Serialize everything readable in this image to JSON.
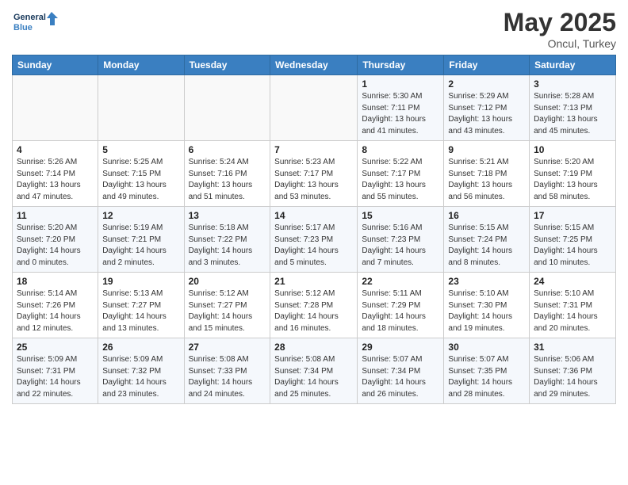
{
  "header": {
    "logo_line1": "General",
    "logo_line2": "Blue",
    "month": "May 2025",
    "location": "Oncul, Turkey"
  },
  "weekdays": [
    "Sunday",
    "Monday",
    "Tuesday",
    "Wednesday",
    "Thursday",
    "Friday",
    "Saturday"
  ],
  "weeks": [
    [
      {
        "day": "",
        "info": ""
      },
      {
        "day": "",
        "info": ""
      },
      {
        "day": "",
        "info": ""
      },
      {
        "day": "",
        "info": ""
      },
      {
        "day": "1",
        "info": "Sunrise: 5:30 AM\nSunset: 7:11 PM\nDaylight: 13 hours\nand 41 minutes."
      },
      {
        "day": "2",
        "info": "Sunrise: 5:29 AM\nSunset: 7:12 PM\nDaylight: 13 hours\nand 43 minutes."
      },
      {
        "day": "3",
        "info": "Sunrise: 5:28 AM\nSunset: 7:13 PM\nDaylight: 13 hours\nand 45 minutes."
      }
    ],
    [
      {
        "day": "4",
        "info": "Sunrise: 5:26 AM\nSunset: 7:14 PM\nDaylight: 13 hours\nand 47 minutes."
      },
      {
        "day": "5",
        "info": "Sunrise: 5:25 AM\nSunset: 7:15 PM\nDaylight: 13 hours\nand 49 minutes."
      },
      {
        "day": "6",
        "info": "Sunrise: 5:24 AM\nSunset: 7:16 PM\nDaylight: 13 hours\nand 51 minutes."
      },
      {
        "day": "7",
        "info": "Sunrise: 5:23 AM\nSunset: 7:17 PM\nDaylight: 13 hours\nand 53 minutes."
      },
      {
        "day": "8",
        "info": "Sunrise: 5:22 AM\nSunset: 7:17 PM\nDaylight: 13 hours\nand 55 minutes."
      },
      {
        "day": "9",
        "info": "Sunrise: 5:21 AM\nSunset: 7:18 PM\nDaylight: 13 hours\nand 56 minutes."
      },
      {
        "day": "10",
        "info": "Sunrise: 5:20 AM\nSunset: 7:19 PM\nDaylight: 13 hours\nand 58 minutes."
      }
    ],
    [
      {
        "day": "11",
        "info": "Sunrise: 5:20 AM\nSunset: 7:20 PM\nDaylight: 14 hours\nand 0 minutes."
      },
      {
        "day": "12",
        "info": "Sunrise: 5:19 AM\nSunset: 7:21 PM\nDaylight: 14 hours\nand 2 minutes."
      },
      {
        "day": "13",
        "info": "Sunrise: 5:18 AM\nSunset: 7:22 PM\nDaylight: 14 hours\nand 3 minutes."
      },
      {
        "day": "14",
        "info": "Sunrise: 5:17 AM\nSunset: 7:23 PM\nDaylight: 14 hours\nand 5 minutes."
      },
      {
        "day": "15",
        "info": "Sunrise: 5:16 AM\nSunset: 7:23 PM\nDaylight: 14 hours\nand 7 minutes."
      },
      {
        "day": "16",
        "info": "Sunrise: 5:15 AM\nSunset: 7:24 PM\nDaylight: 14 hours\nand 8 minutes."
      },
      {
        "day": "17",
        "info": "Sunrise: 5:15 AM\nSunset: 7:25 PM\nDaylight: 14 hours\nand 10 minutes."
      }
    ],
    [
      {
        "day": "18",
        "info": "Sunrise: 5:14 AM\nSunset: 7:26 PM\nDaylight: 14 hours\nand 12 minutes."
      },
      {
        "day": "19",
        "info": "Sunrise: 5:13 AM\nSunset: 7:27 PM\nDaylight: 14 hours\nand 13 minutes."
      },
      {
        "day": "20",
        "info": "Sunrise: 5:12 AM\nSunset: 7:27 PM\nDaylight: 14 hours\nand 15 minutes."
      },
      {
        "day": "21",
        "info": "Sunrise: 5:12 AM\nSunset: 7:28 PM\nDaylight: 14 hours\nand 16 minutes."
      },
      {
        "day": "22",
        "info": "Sunrise: 5:11 AM\nSunset: 7:29 PM\nDaylight: 14 hours\nand 18 minutes."
      },
      {
        "day": "23",
        "info": "Sunrise: 5:10 AM\nSunset: 7:30 PM\nDaylight: 14 hours\nand 19 minutes."
      },
      {
        "day": "24",
        "info": "Sunrise: 5:10 AM\nSunset: 7:31 PM\nDaylight: 14 hours\nand 20 minutes."
      }
    ],
    [
      {
        "day": "25",
        "info": "Sunrise: 5:09 AM\nSunset: 7:31 PM\nDaylight: 14 hours\nand 22 minutes."
      },
      {
        "day": "26",
        "info": "Sunrise: 5:09 AM\nSunset: 7:32 PM\nDaylight: 14 hours\nand 23 minutes."
      },
      {
        "day": "27",
        "info": "Sunrise: 5:08 AM\nSunset: 7:33 PM\nDaylight: 14 hours\nand 24 minutes."
      },
      {
        "day": "28",
        "info": "Sunrise: 5:08 AM\nSunset: 7:34 PM\nDaylight: 14 hours\nand 25 minutes."
      },
      {
        "day": "29",
        "info": "Sunrise: 5:07 AM\nSunset: 7:34 PM\nDaylight: 14 hours\nand 26 minutes."
      },
      {
        "day": "30",
        "info": "Sunrise: 5:07 AM\nSunset: 7:35 PM\nDaylight: 14 hours\nand 28 minutes."
      },
      {
        "day": "31",
        "info": "Sunrise: 5:06 AM\nSunset: 7:36 PM\nDaylight: 14 hours\nand 29 minutes."
      }
    ]
  ]
}
